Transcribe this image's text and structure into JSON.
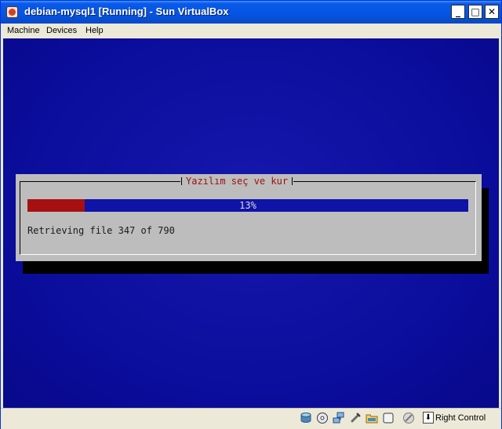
{
  "window": {
    "title": "debian-mysql1 [Running] - Sun VirtualBox",
    "controls": {
      "minimize": "_",
      "maximize": "□",
      "close": "✕"
    }
  },
  "menubar": {
    "items": [
      "Machine",
      "Devices",
      "Help"
    ]
  },
  "guest": {
    "dialog": {
      "title": "Yazılım seç ve kur",
      "progress": {
        "value": 0.13,
        "label": "13%"
      },
      "status": "Retrieving file 347 of 790"
    }
  },
  "statusbar": {
    "icons": [
      "hard-disk-icon",
      "cd-dvd-icon",
      "network-icon",
      "usb-icon",
      "shared-folders-icon",
      "display-icon",
      "mouse-integration-icon",
      "host-key-icon"
    ],
    "host_key_label": "Right Control"
  },
  "colors": {
    "titlebar": "#0554e3",
    "guest_background": "#0b0d9e",
    "dialog_background": "#bdbdbd",
    "progress_fill": "#a61010",
    "progress_track": "#0f13a8",
    "dialog_title": "#9b1010"
  }
}
